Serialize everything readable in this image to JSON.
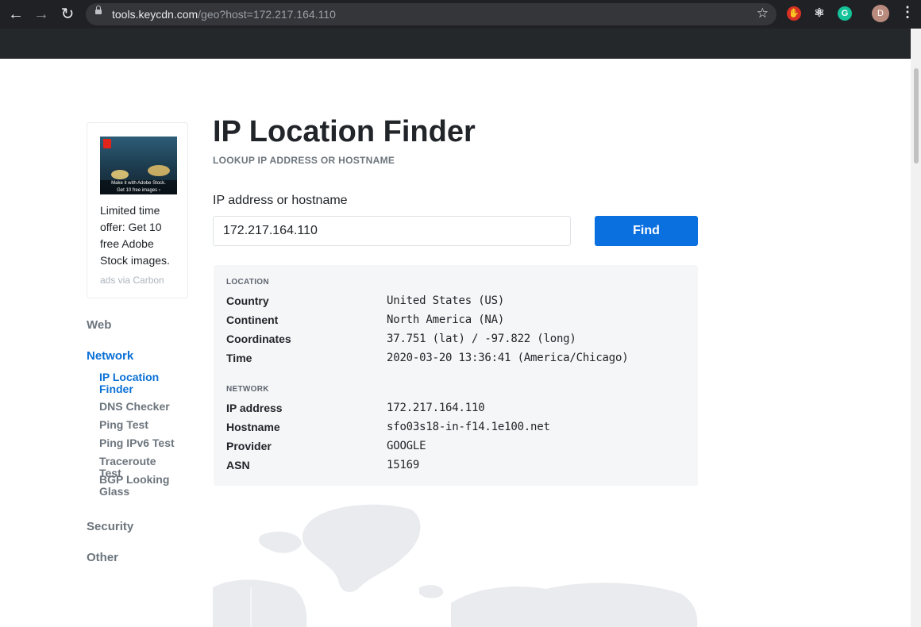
{
  "browser": {
    "url_host": "tools.keycdn.com",
    "url_path": "/geo?host=172.217.164.110",
    "avatar_initial": "D"
  },
  "ad": {
    "image_caption": "Make it with Adobe Stock.",
    "image_subcaption": "Get 10 free images ›",
    "text": "Limited time offer: Get 10 free Adobe Stock images.",
    "via": "ads via Carbon"
  },
  "sidebar": {
    "categories": [
      "Web",
      "Network",
      "Security",
      "Other"
    ],
    "network_items": [
      "IP Location Finder",
      "DNS Checker",
      "Ping Test",
      "Ping IPv6 Test",
      "Traceroute Test",
      "BGP Looking Glass"
    ]
  },
  "page": {
    "title": "IP Location Finder",
    "subtitle": "LOOKUP IP ADDRESS OR HOSTNAME",
    "input_label": "IP address or hostname",
    "input_value": "172.217.164.110",
    "find_label": "Find"
  },
  "results": {
    "location_heading": "LOCATION",
    "location": [
      {
        "key": "Country",
        "value": "United States (US)"
      },
      {
        "key": "Continent",
        "value": "North America (NA)"
      },
      {
        "key": "Coordinates",
        "value": "37.751 (lat) / -97.822 (long)"
      },
      {
        "key": "Time",
        "value": "2020-03-20 13:36:41 (America/Chicago)"
      }
    ],
    "network_heading": "NETWORK",
    "network": [
      {
        "key": "IP address",
        "value": "172.217.164.110"
      },
      {
        "key": "Hostname",
        "value": "sfo03s18-in-f14.1e100.net"
      },
      {
        "key": "Provider",
        "value": "GOOGLE"
      },
      {
        "key": "ASN",
        "value": "15169"
      }
    ]
  }
}
